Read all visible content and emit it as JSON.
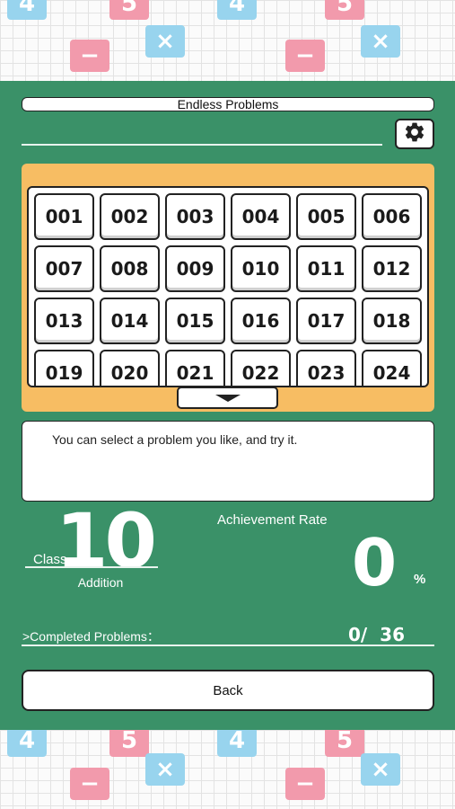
{
  "header": {
    "title": "Endless Problems",
    "settings_icon": "gear-icon"
  },
  "problems": [
    "001",
    "002",
    "003",
    "004",
    "005",
    "006",
    "007",
    "008",
    "009",
    "010",
    "011",
    "012",
    "013",
    "014",
    "015",
    "016",
    "017",
    "018",
    "019",
    "020",
    "021",
    "022",
    "023",
    "024"
  ],
  "description": "You can select a problem you like, and try it.",
  "class_info": {
    "label": "Class",
    "number": "10",
    "category": "Addition"
  },
  "achievement": {
    "label": "Achievement Rate",
    "value": "0",
    "unit": "%"
  },
  "completed": {
    "label": ">Completed Problems：",
    "value": "0/  36"
  },
  "back_label": "Back",
  "colors": {
    "panel": "#3a9168",
    "frame": "#f7bd63",
    "tile_pink": "#f29aac",
    "tile_blue": "#98d4ee"
  },
  "background_tiles": {
    "top": [
      "4",
      "5",
      "4",
      "5",
      "−",
      "×",
      "−",
      "×"
    ],
    "bottom": [
      "4",
      "5",
      "4",
      "5",
      "−",
      "×",
      "−",
      "×"
    ]
  }
}
